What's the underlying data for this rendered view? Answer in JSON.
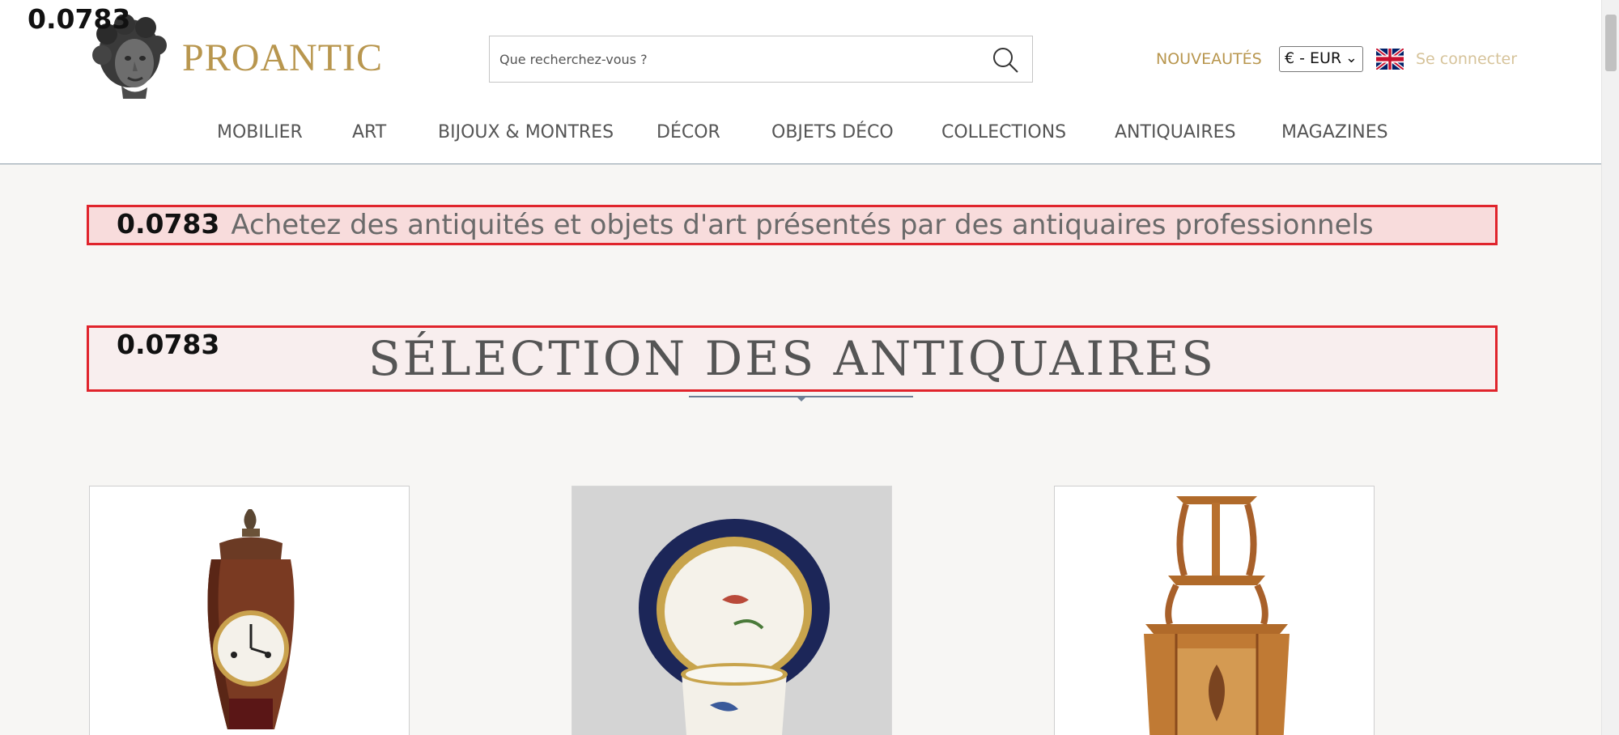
{
  "debug": {
    "value": "0.0783"
  },
  "logo": {
    "text": "PROANTIC"
  },
  "search": {
    "placeholder": "Que recherchez-vous ?"
  },
  "header": {
    "new_label": "NOUVEAUTÉS",
    "currency": "€ - EUR",
    "login_label": "Se connecter"
  },
  "nav": {
    "items": [
      {
        "label": "MOBILIER"
      },
      {
        "label": "ART"
      },
      {
        "label": "BIJOUX & MONTRES"
      },
      {
        "label": "DÉCOR"
      },
      {
        "label": "OBJETS DÉCO"
      },
      {
        "label": "COLLECTIONS"
      },
      {
        "label": "ANTIQUAIRES"
      },
      {
        "label": "MAGAZINES"
      }
    ]
  },
  "banner": {
    "text": "Achetez des antiquités et objets d'art présentés par des antiquaires professionnels"
  },
  "section": {
    "title": "SÉLECTION DES ANTIQUAIRES"
  },
  "products": [
    {
      "image": "bracket-clock"
    },
    {
      "image": "porcelain-cup-saucer"
    },
    {
      "image": "corner-etagere"
    }
  ],
  "colors": {
    "gold": "#b8964e",
    "banner_border": "#e0242c",
    "banner_bg": "#f8dcdc"
  }
}
